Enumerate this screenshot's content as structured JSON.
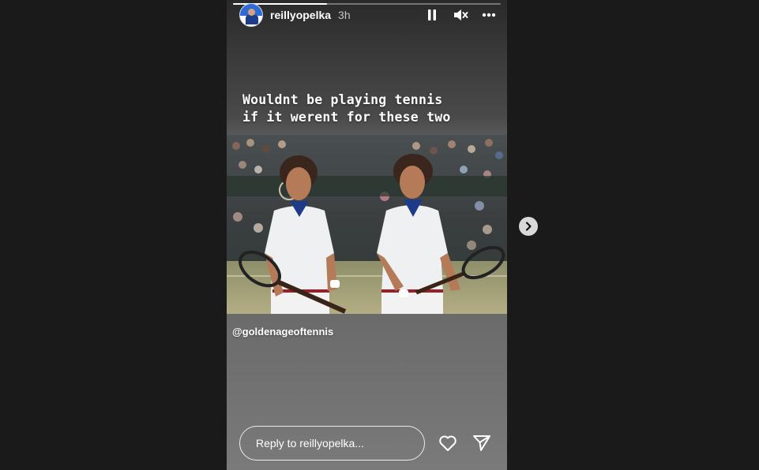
{
  "story": {
    "progress": 0.35,
    "header": {
      "username": "reillyopelka",
      "time": "3h",
      "icons": [
        "pause-icon",
        "muted-icon",
        "more-icon"
      ]
    },
    "caption": {
      "line1": "Wouldnt be playing tennis",
      "line2": "if it werent for these two"
    },
    "credit": "@goldenageoftennis",
    "reply": {
      "placeholder": "Reply to reillyopelka..."
    },
    "actions": [
      "heart-icon",
      "send-icon"
    ]
  },
  "navigation": {
    "next_icon": "chevron-right-icon"
  },
  "colors": {
    "page_background": "#1a1a1a",
    "text": "#ffffff",
    "next_button": "#d9d9d9"
  }
}
